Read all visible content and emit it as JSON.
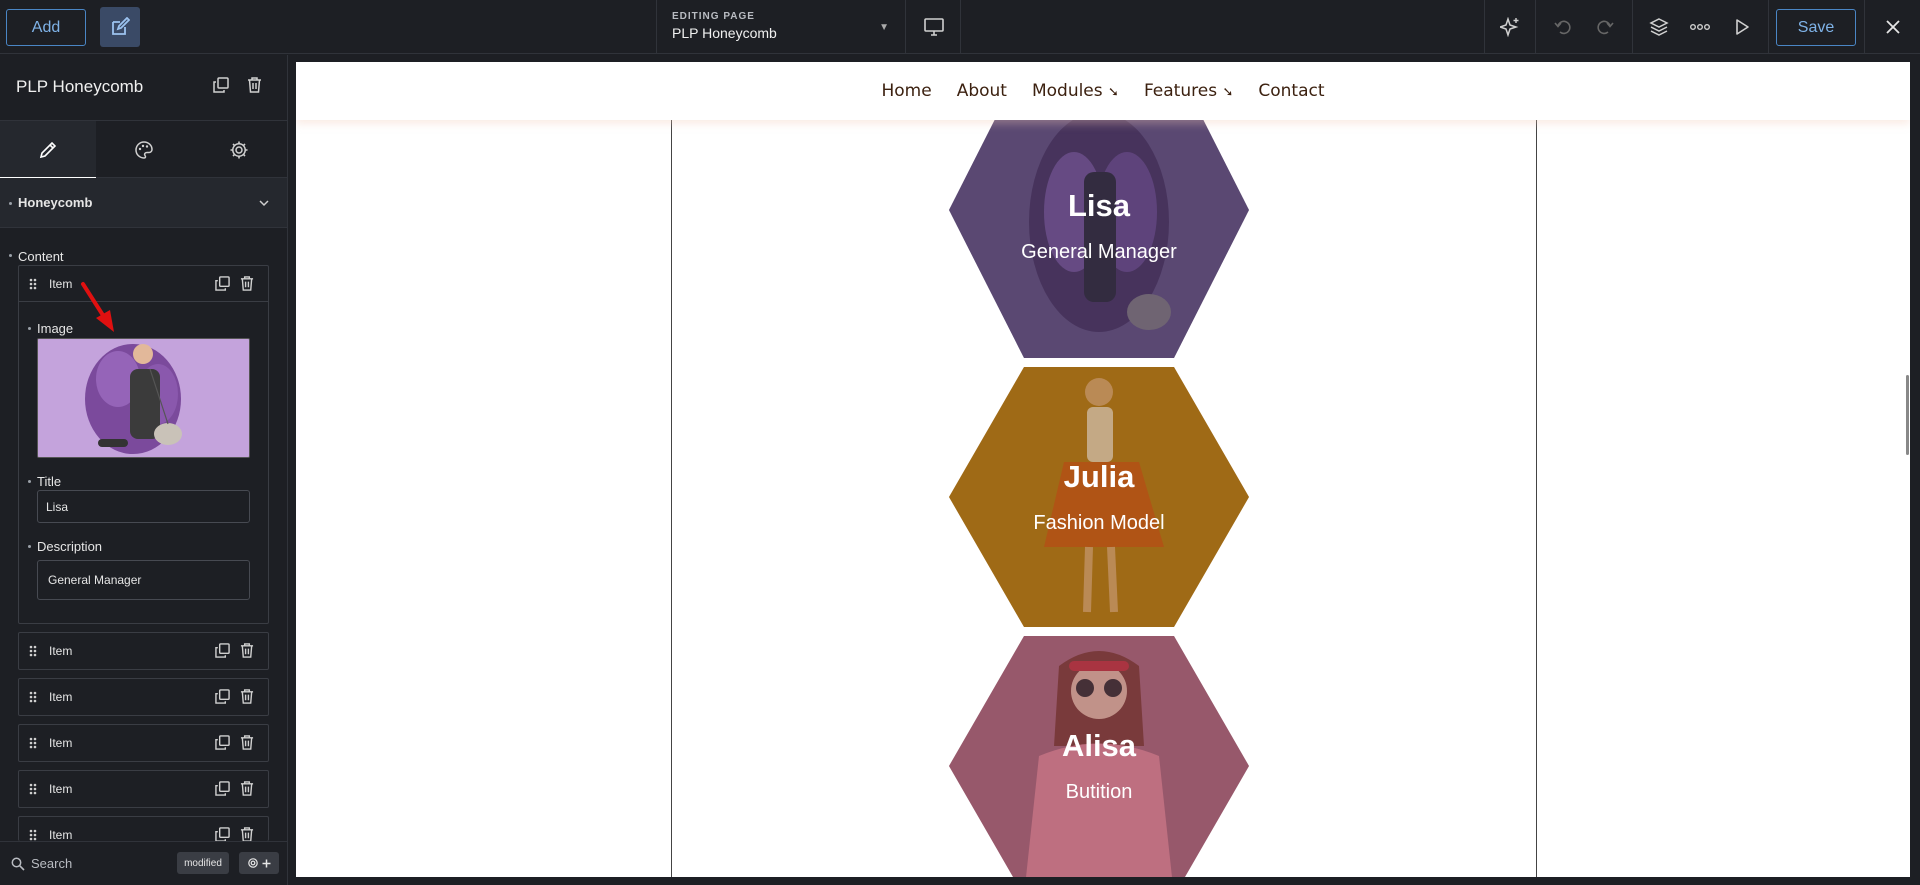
{
  "topbar": {
    "add_label": "Add",
    "editing_label": "EDITING PAGE",
    "page_name": "PLP Honeycomb",
    "save_label": "Save"
  },
  "panel": {
    "module_title": "PLP Honeycomb",
    "section_title": "Honeycomb",
    "content_label": "Content",
    "items": [
      {
        "label": "Item",
        "expanded": true,
        "fields": {
          "image_label": "Image",
          "title_label": "Title",
          "title_value": "Lisa",
          "description_label": "Description",
          "description_value": "General Manager"
        }
      },
      {
        "label": "Item"
      },
      {
        "label": "Item"
      },
      {
        "label": "Item"
      },
      {
        "label": "Item"
      },
      {
        "label": "Item"
      }
    ],
    "search_placeholder": "Search",
    "modified_badge": "modified"
  },
  "site": {
    "nav": [
      "Home",
      "About",
      "Modules",
      "Features",
      "Contact"
    ],
    "nav_dropdown_marker": "➘",
    "cards": [
      {
        "title": "Lisa",
        "description": "General Manager",
        "color": "#5b4670"
      },
      {
        "title": "Julia",
        "description": "Fashion Model",
        "color": "#a86d1c"
      },
      {
        "title": "Alisa",
        "description": "Butition",
        "color": "#9c5e6c"
      }
    ]
  },
  "colors": {
    "accent": "#4a86c5",
    "panel_bg": "#1d1f24",
    "nav_text": "#3c2110",
    "annotation_arrow": "#e01010"
  }
}
